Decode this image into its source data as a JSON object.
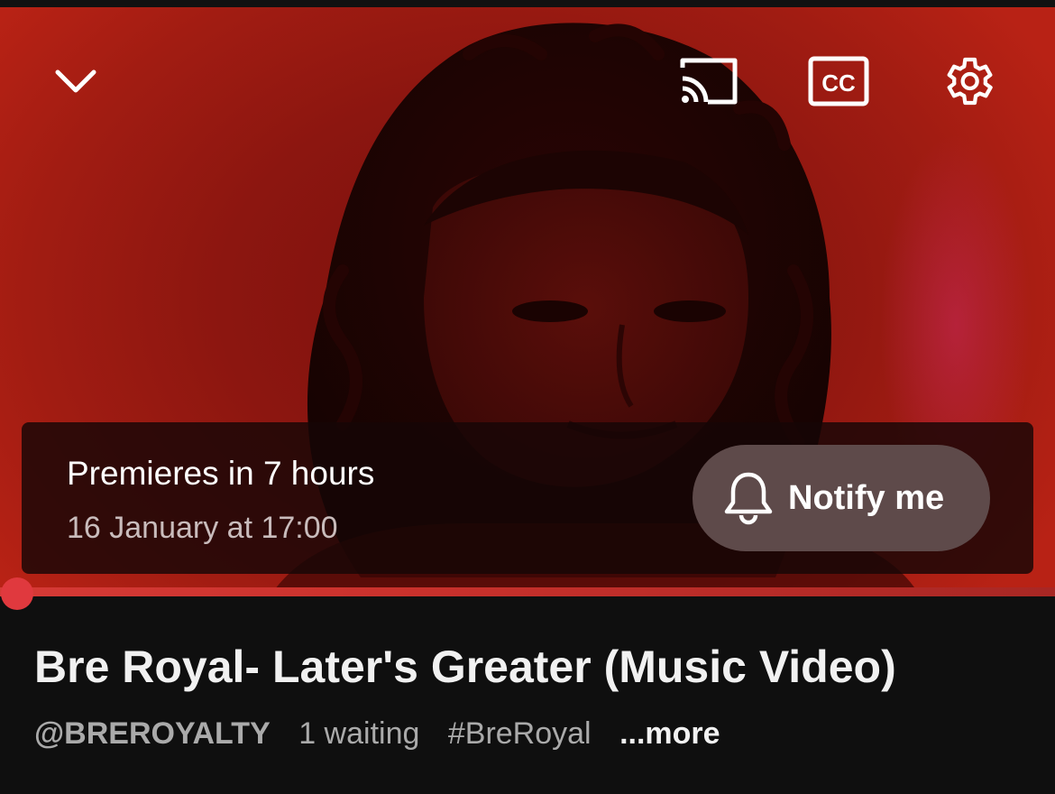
{
  "player": {
    "controls": {
      "collapse": "chevron-down-icon",
      "cast": "cast-icon",
      "captions": "closed-captions-icon",
      "captions_text": "CC",
      "settings": "gear-icon"
    },
    "premiere": {
      "title": "Premieres in 7 hours",
      "date": "16 January at 17:00",
      "notify_label": "Notify me",
      "notify_icon": "bell-icon"
    },
    "progress": {
      "value": 0,
      "accent_color": "#e0393e"
    }
  },
  "video": {
    "title": "Bre Royal- Later's Greater (Music Video)",
    "channel": "@BREROYALTY",
    "waiting": "1 waiting",
    "hashtag": "#BreRoyal",
    "more": "...more"
  }
}
